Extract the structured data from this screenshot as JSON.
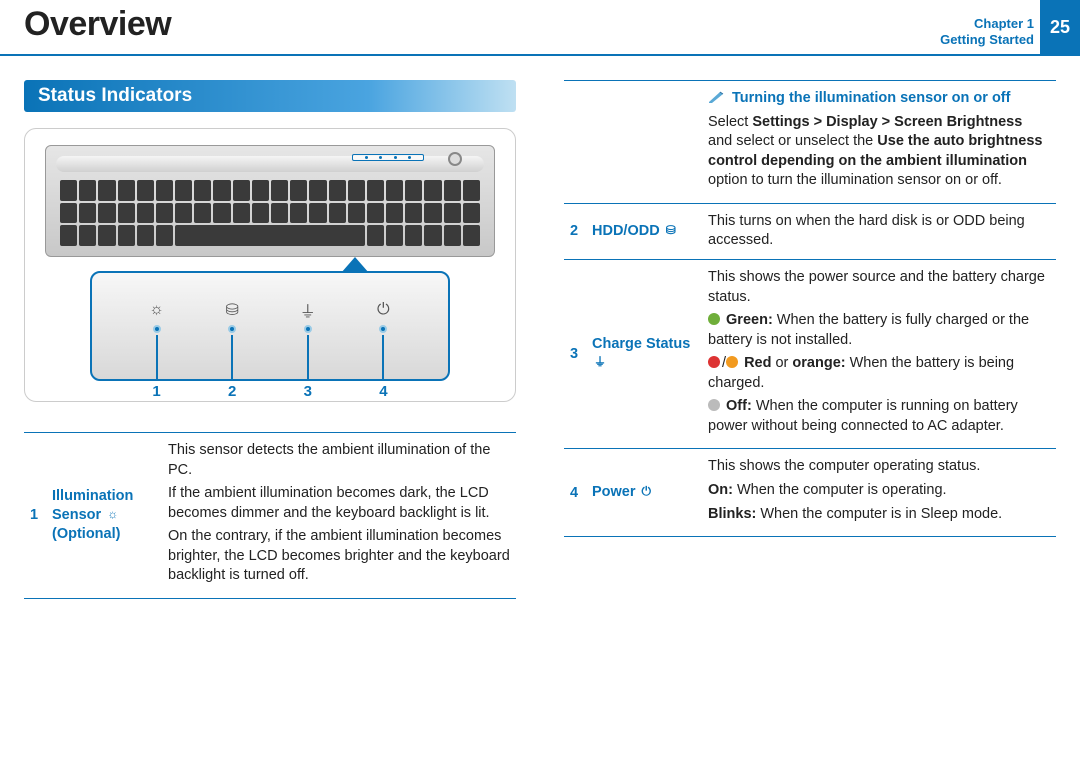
{
  "header": {
    "title": "Overview",
    "chapter_line1": "Chapter 1",
    "chapter_line2": "Getting Started",
    "page": "25"
  },
  "section": {
    "heading": "Status Indicators"
  },
  "fig_labels": {
    "n1": "1",
    "n2": "2",
    "n3": "3",
    "n4": "4"
  },
  "row1": {
    "num": "1",
    "label": "Illumination Sensor",
    "opt": "(Optional)",
    "icon": "☼",
    "p1": "This sensor detects the ambient illumination of the PC.",
    "p2": "If the ambient illumination becomes dark, the LCD becomes dimmer and the keyboard backlight is lit.",
    "p3": "On the contrary, if the ambient illumination becomes brighter, the LCD becomes brighter and the keyboard backlight is turned off."
  },
  "note": {
    "title": "Turning the illumination sensor on or off",
    "t1": "Select ",
    "b1": "Settings > Display > Screen Brightness",
    "t2": " and select or unselect the ",
    "b2": "Use the auto brightness control depending on the ambient illumination",
    "t3": " option to turn the illumination sensor on or off."
  },
  "row2": {
    "num": "2",
    "label": "HDD/ODD",
    "icon": "⛁",
    "desc": "This turns on when the hard disk is or ODD being accessed."
  },
  "row3": {
    "num": "3",
    "label": "Charge Status",
    "icon": "⏚",
    "intro": "This shows the power source and the battery charge status.",
    "g_l": "Green:",
    "g_t": " When the battery is fully charged or the battery is not installed.",
    "r_l": "Red",
    "r_m": " or ",
    "o_l": "orange:",
    "r_t": " When the battery is being charged.",
    "off_l": "Off:",
    "off_t": " When the computer is running on battery power without being connected to AC adapter."
  },
  "row4": {
    "num": "4",
    "label": "Power",
    "icon": "⏻",
    "intro": "This shows the computer operating status.",
    "on_l": "On:",
    "on_t": " When the computer is operating.",
    "bl_l": "Blinks:",
    "bl_t": " When the computer is in Sleep mode."
  }
}
